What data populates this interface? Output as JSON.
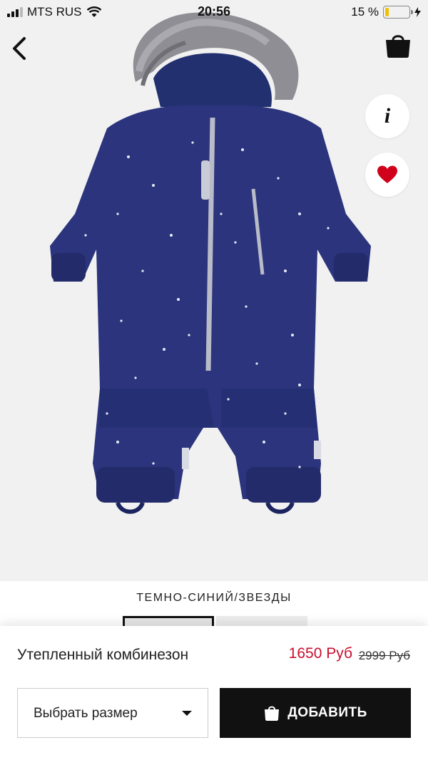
{
  "status_bar": {
    "carrier": "MTS RUS",
    "time": "20:56",
    "battery_label": "15 %",
    "battery_level": 0.15,
    "signal_bars": 3
  },
  "nav": {
    "back_icon": "chevron-left-icon",
    "bag_icon": "shopping-bag-icon"
  },
  "actions": {
    "info_label": "i",
    "favorite_icon": "heart-icon",
    "favorite_color": "#d0021b"
  },
  "product": {
    "color_name": "ТЕМНО-СИНИЙ/ЗВЕЗДЫ",
    "name": "Утепленный комбинезон",
    "price_current": "1650 Руб",
    "price_old": "2999 Руб",
    "suit_color": "#2b347c",
    "price_color": "#c8102e"
  },
  "purchase": {
    "size_placeholder": "Выбрать размер",
    "add_label": "ДОБАВИТЬ"
  }
}
